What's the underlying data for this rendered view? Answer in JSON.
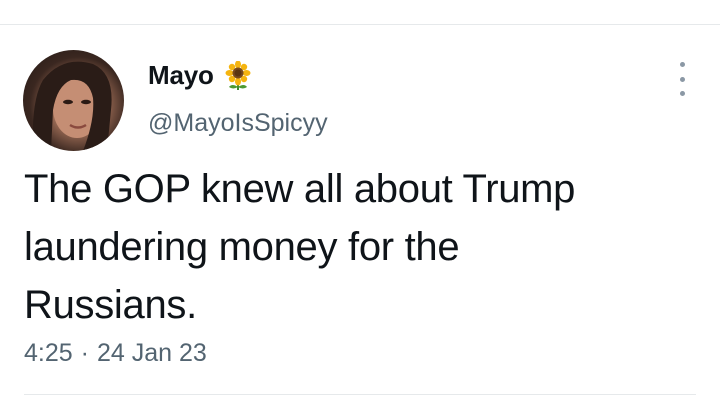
{
  "tweet": {
    "author": {
      "display_name": "Mayo",
      "handle": "@MayoIsSpicyy",
      "emoji_icon": "sunflower-icon"
    },
    "text_lines": [
      "The GOP knew all about Trump",
      "laundering money for the",
      "Russians."
    ],
    "time": "4:25",
    "separator": "·",
    "date": "24 Jan 23"
  },
  "colors": {
    "text_primary": "#0f1419",
    "text_secondary": "#536471",
    "divider": "#e6e9eb"
  }
}
